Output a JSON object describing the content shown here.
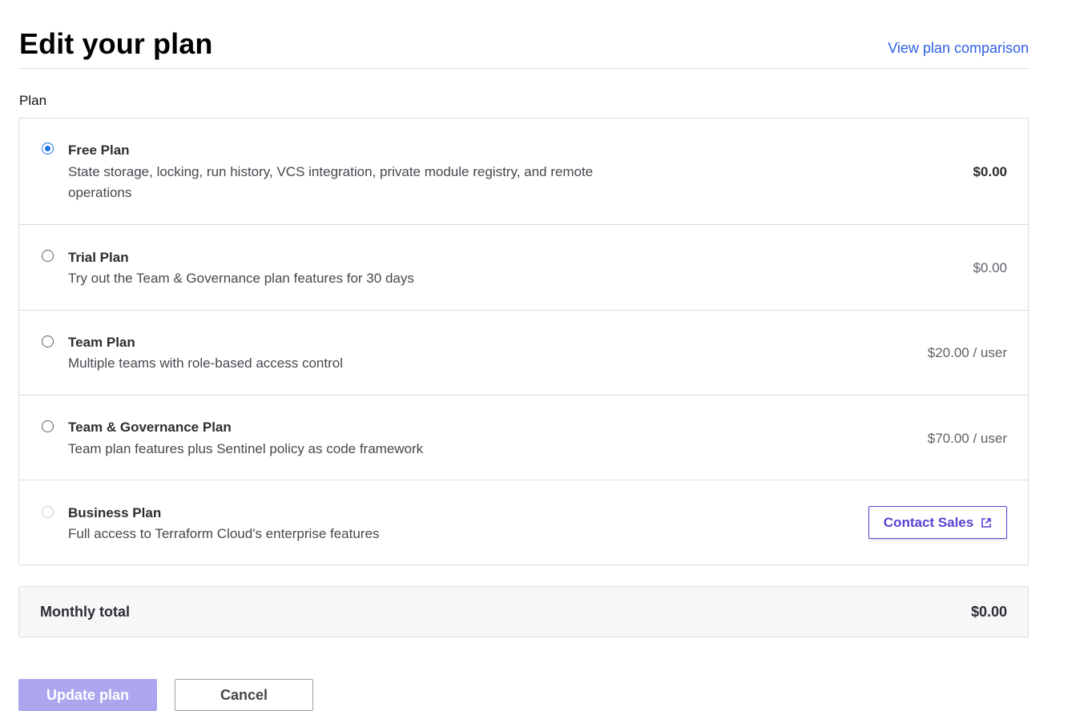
{
  "header": {
    "title": "Edit your plan",
    "compare_link": "View plan comparison"
  },
  "plan_section": {
    "label": "Plan",
    "plans": [
      {
        "name": "Free Plan",
        "description": "State storage, locking, run history, VCS integration, private module registry, and remote operations",
        "price": "$0.00",
        "selected": true,
        "disabled": false
      },
      {
        "name": "Trial Plan",
        "description": "Try out the Team & Governance plan features for 30 days",
        "price": "$0.00",
        "selected": false,
        "disabled": false
      },
      {
        "name": "Team Plan",
        "description": "Multiple teams with role-based access control",
        "price": "$20.00 / user",
        "selected": false,
        "disabled": false
      },
      {
        "name": "Team & Governance Plan",
        "description": "Team plan features plus Sentinel policy as code framework",
        "price": "$70.00 / user",
        "selected": false,
        "disabled": false
      },
      {
        "name": "Business Plan",
        "description": "Full access to Terraform Cloud's enterprise features",
        "action_label": "Contact Sales",
        "action_icon": "external-link-icon",
        "selected": false,
        "disabled": true
      }
    ]
  },
  "total": {
    "label": "Monthly total",
    "value": "$0.00"
  },
  "actions": {
    "update_label": "Update plan",
    "cancel_label": "Cancel"
  },
  "colors": {
    "link": "#2f5fe8",
    "radio_selected": "#1a73e8",
    "brand_purple": "#5b3fd1",
    "update_button_disabled": "#aca6ee"
  }
}
